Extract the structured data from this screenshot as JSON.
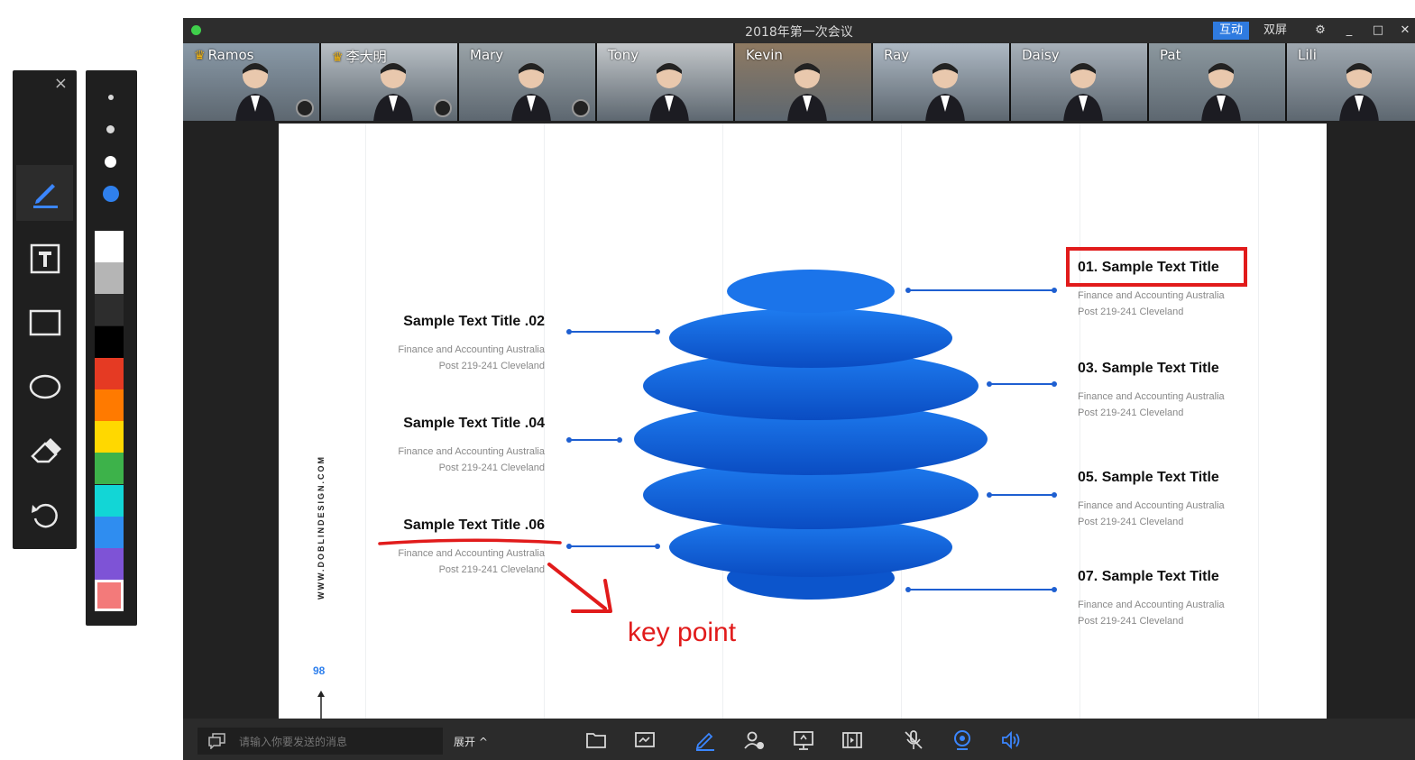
{
  "window": {
    "title": "2018年第一次会议",
    "interact_label": "互动",
    "dual_screen_label": "双屏",
    "settings_glyph": "⚙",
    "minimize_glyph": "_",
    "maximize_glyph": "□",
    "close_glyph": "✕"
  },
  "tool_panel": {
    "close_glyph": "×",
    "tools": [
      {
        "name": "select-move-tool",
        "icon": "move-cursor-icon"
      },
      {
        "name": "pen-tool",
        "icon": "pen-icon",
        "active": true
      },
      {
        "name": "text-tool",
        "icon": "text-box-icon"
      },
      {
        "name": "rectangle-tool",
        "icon": "rectangle-icon"
      },
      {
        "name": "ellipse-tool",
        "icon": "ellipse-icon"
      },
      {
        "name": "eraser-tool",
        "icon": "eraser-icon"
      },
      {
        "name": "undo-tool",
        "icon": "undo-icon"
      }
    ]
  },
  "palette": {
    "brush_sizes": 4,
    "selected_size_color": "#2f80ed",
    "colors": [
      "#ffffff",
      "#b5b5b5",
      "#2d2d2d",
      "#000000",
      "#e53a23",
      "#ff7a00",
      "#ffd800",
      "#3db24a",
      "#12d6d6",
      "#2f8df0",
      "#7e53d6",
      "#f37a7a"
    ],
    "selected_color": "#f37a7a"
  },
  "participants": [
    {
      "name": "Ramos",
      "host": true,
      "mic": true
    },
    {
      "name": "李大明",
      "host": true,
      "mic": true
    },
    {
      "name": "Mary",
      "host": false,
      "mic": true
    },
    {
      "name": "Tony",
      "host": false,
      "mic": false
    },
    {
      "name": "Kevin",
      "host": false,
      "mic": false
    },
    {
      "name": "Ray",
      "host": false,
      "mic": false
    },
    {
      "name": "Daisy",
      "host": false,
      "mic": false
    },
    {
      "name": "Pat",
      "host": false,
      "mic": false
    },
    {
      "name": "Lili",
      "host": false,
      "mic": false
    }
  ],
  "slide": {
    "left_items": [
      {
        "title": "Sample Text Title .02",
        "line1": "Finance and Accounting Australia",
        "line2": "Post 219-241 Cleveland"
      },
      {
        "title": "Sample Text Title .04",
        "line1": "Finance and Accounting Australia",
        "line2": "Post 219-241 Cleveland"
      },
      {
        "title": "Sample Text Title .06",
        "line1": "Finance and Accounting Australia",
        "line2": "Post 219-241 Cleveland"
      }
    ],
    "right_items": [
      {
        "title": "01. Sample Text Title",
        "line1": "Finance and Accounting Australia",
        "line2": "Post 219-241 Cleveland"
      },
      {
        "title": "03. Sample Text Title",
        "line1": "Finance and Accounting Australia",
        "line2": "Post 219-241 Cleveland"
      },
      {
        "title": "05. Sample Text Title",
        "line1": "Finance and Accounting Australia",
        "line2": "Post 219-241 Cleveland"
      },
      {
        "title": "07. Sample Text Title",
        "line1": "Finance and Accounting Australia",
        "line2": "Post 219-241 Cleveland"
      }
    ],
    "vertical_url": "WWW.DOBLINDESIGN.COM",
    "page_number": "98",
    "annotation_text": "key point",
    "annotation_color": "#e11b1b",
    "accent_color": "#1e5fd1"
  },
  "bottom_bar": {
    "chat_placeholder": "请输入你要发送的消息",
    "expand_label": "展开 ^",
    "icons": [
      "folder-icon",
      "whiteboard-icon",
      "annotate-pen-icon",
      "participants-icon",
      "screen-share-icon",
      "media-play-icon",
      "mic-muted-icon",
      "camera-icon",
      "speaker-icon"
    ]
  }
}
